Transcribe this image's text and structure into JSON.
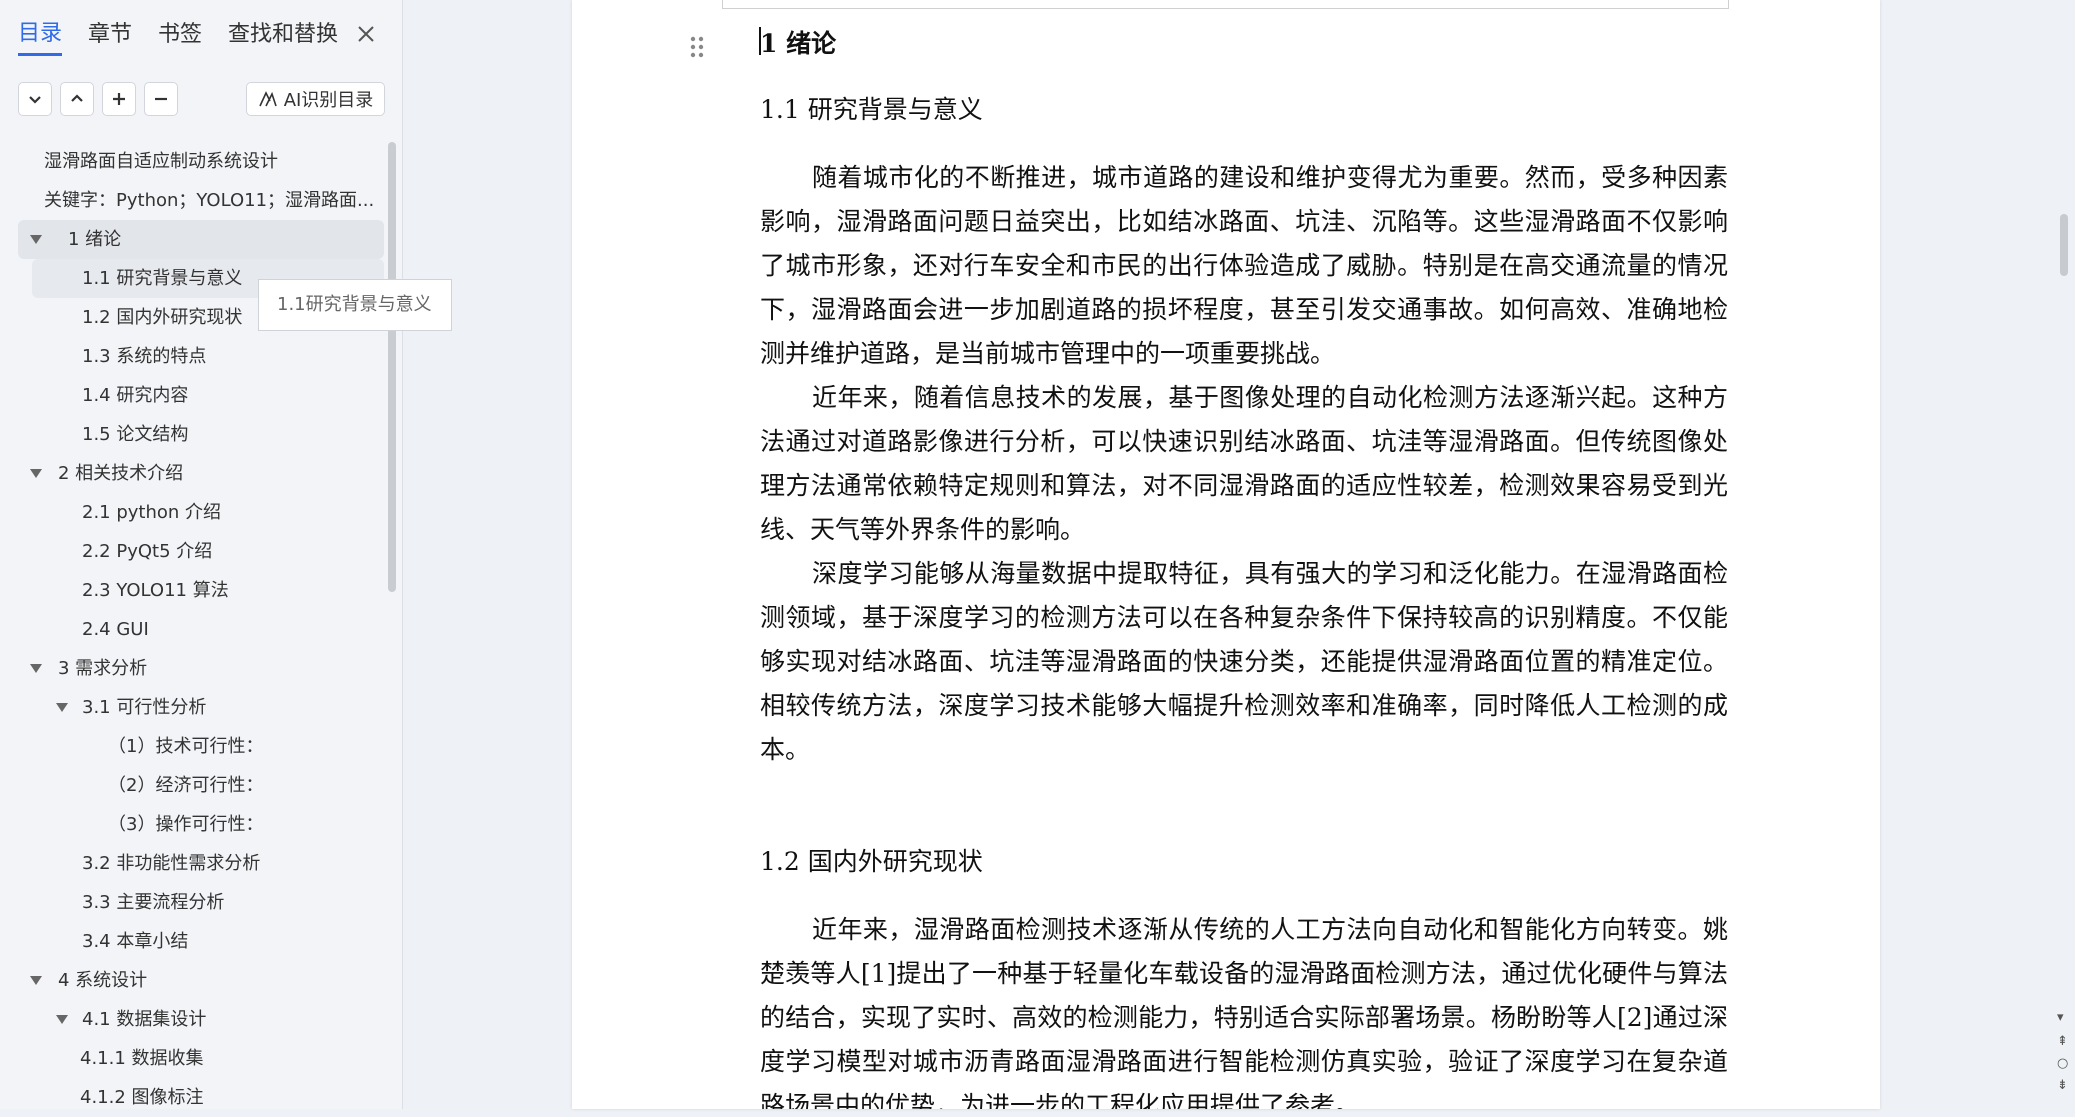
{
  "nav": {
    "tabs": [
      "目录",
      "章节",
      "书签",
      "查找和替换"
    ],
    "active_tab": 0,
    "ai_button": "AI识别目录",
    "tooltip": "1.1研究背景与意义",
    "toc": [
      {
        "label": "湿滑路面自适应制动系统设计",
        "level": 1,
        "arrow": false
      },
      {
        "label": "关键字：Python；YOLO11；湿滑路面...",
        "level": 1,
        "arrow": false
      },
      {
        "label": "1  绪论",
        "level": 1,
        "arrow": true,
        "state": "sel"
      },
      {
        "label": "1.1 研究背景与意义",
        "level": 2,
        "arrow": false,
        "state": "cur"
      },
      {
        "label": "1.2 国内外研究现状",
        "level": 2,
        "arrow": false
      },
      {
        "label": "1.3 系统的特点",
        "level": 2,
        "arrow": false
      },
      {
        "label": "1.4 研究内容",
        "level": 2,
        "arrow": false
      },
      {
        "label": "1.5 论文结构",
        "level": 2,
        "arrow": false
      },
      {
        "label": "2  相关技术介绍",
        "level": 1,
        "arrow": true
      },
      {
        "label": "2.1 python 介绍",
        "level": 2,
        "arrow": false
      },
      {
        "label": "2.2 PyQt5 介绍",
        "level": 2,
        "arrow": false
      },
      {
        "label": "2.3 YOLO11 算法",
        "level": 2,
        "arrow": false
      },
      {
        "label": "2.4 GUI",
        "level": 2,
        "arrow": false
      },
      {
        "label": "3  需求分析",
        "level": 1,
        "arrow": true
      },
      {
        "label": "3.1 可行性分析",
        "level": 2,
        "arrow": true
      },
      {
        "label": "（1）技术可行性：",
        "level": 3,
        "arrow": false
      },
      {
        "label": "（2）经济可行性：",
        "level": 3,
        "arrow": false
      },
      {
        "label": "（3）操作可行性：",
        "level": 3,
        "arrow": false
      },
      {
        "label": "3.2  非功能性需求分析",
        "level": 2,
        "arrow": false
      },
      {
        "label": "3.3 主要流程分析",
        "level": 2,
        "arrow": false
      },
      {
        "label": "3.4 本章小结",
        "level": 2,
        "arrow": false
      },
      {
        "label": "4  系统设计",
        "level": 1,
        "arrow": true
      },
      {
        "label": "4.1  数据集设计",
        "level": 2,
        "arrow": true
      },
      {
        "label": "4.1.1 数据收集",
        "level": 3,
        "arrow": false
      },
      {
        "label": "4.1.2 图像标注",
        "level": 3,
        "arrow": false
      }
    ]
  },
  "doc": {
    "h1": "1  绪论",
    "h2_1": "1.1 研究背景与意义",
    "p1": "随着城市化的不断推进，城市道路的建设和维护变得尤为重要。然而，受多种因素影响，湿滑路面问题日益突出，比如结冰路面、坑洼、沉陷等。这些湿滑路面不仅影响了城市形象，还对行车安全和市民的出行体验造成了威胁。特别是在高交通流量的情况下，湿滑路面会进一步加剧道路的损坏程度，甚至引发交通事故。如何高效、准确地检测并维护道路，是当前城市管理中的一项重要挑战。",
    "p2": "近年来，随着信息技术的发展，基于图像处理的自动化检测方法逐渐兴起。这种方法通过对道路影像进行分析，可以快速识别结冰路面、坑洼等湿滑路面。但传统图像处理方法通常依赖特定规则和算法，对不同湿滑路面的适应性较差，检测效果容易受到光线、天气等外界条件的影响。",
    "p3": "深度学习能够从海量数据中提取特征，具有强大的学习和泛化能力。在湿滑路面检测领域，基于深度学习的检测方法可以在各种复杂条件下保持较高的识别精度。不仅能够实现对结冰路面、坑洼等湿滑路面的快速分类，还能提供湿滑路面位置的精准定位。相较传统方法，深度学习技术能够大幅提升检测效率和准确率，同时降低人工检测的成本。",
    "h2_2": "1.2 国内外研究现状",
    "p4": "近年来，湿滑路面检测技术逐渐从传统的人工方法向自动化和智能化方向转变。姚楚羡等人[1]提出了一种基于轻量化车载设备的湿滑路面检测方法，通过优化硬件与算法的结合，实现了实时、高效的检测能力，特别适合实际部署场景。杨盼盼等人[2]通过深度学习模型对城市沥青路面湿滑路面进行智能检测仿真实验，验证了深度学习在复杂道路场景中的优势，为进一步的工程化应用提供了参考。"
  },
  "colors": {
    "accent": "#2f6be8",
    "panel": "#f2f4f7",
    "page": "#ffffff"
  }
}
